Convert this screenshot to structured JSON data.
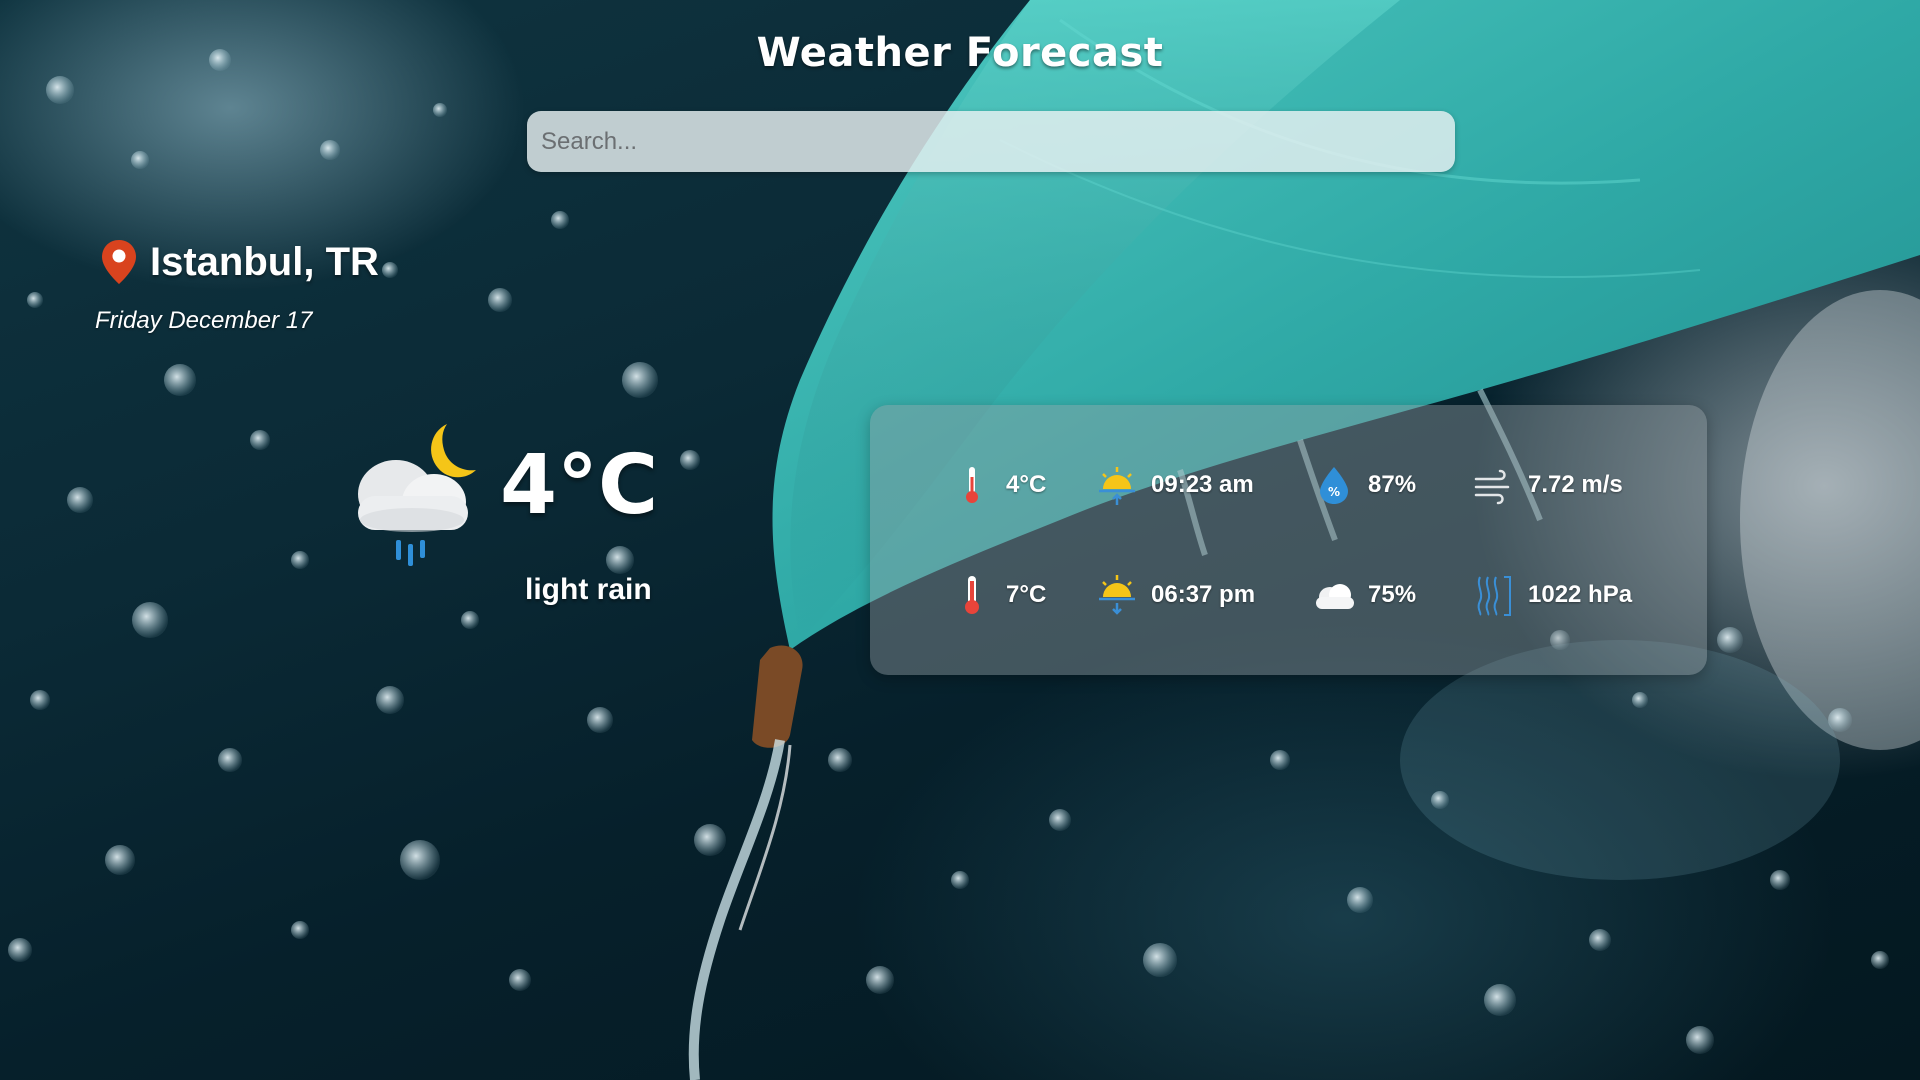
{
  "app": {
    "title": "Weather Forecast"
  },
  "search": {
    "placeholder": "Search..."
  },
  "location": {
    "city": "Istanbul, TR",
    "date": "Friday December 17"
  },
  "current": {
    "temperature": "4°C",
    "description": "light rain",
    "icon": "cloud-moon-rain-icon"
  },
  "details": {
    "temp_min": "4°C",
    "sunrise": "09:23 am",
    "humidity": "87%",
    "wind": "7.72 m/s",
    "temp_max": "7°C",
    "sunset": "06:37 pm",
    "clouds": "75%",
    "pressure": "1022 hPa"
  },
  "colors": {
    "pin": "#d9431e",
    "moon": "#f5c518",
    "rain": "#2f8fd8",
    "thermometer": "#e8443a",
    "panel": "#9aa2a6"
  }
}
